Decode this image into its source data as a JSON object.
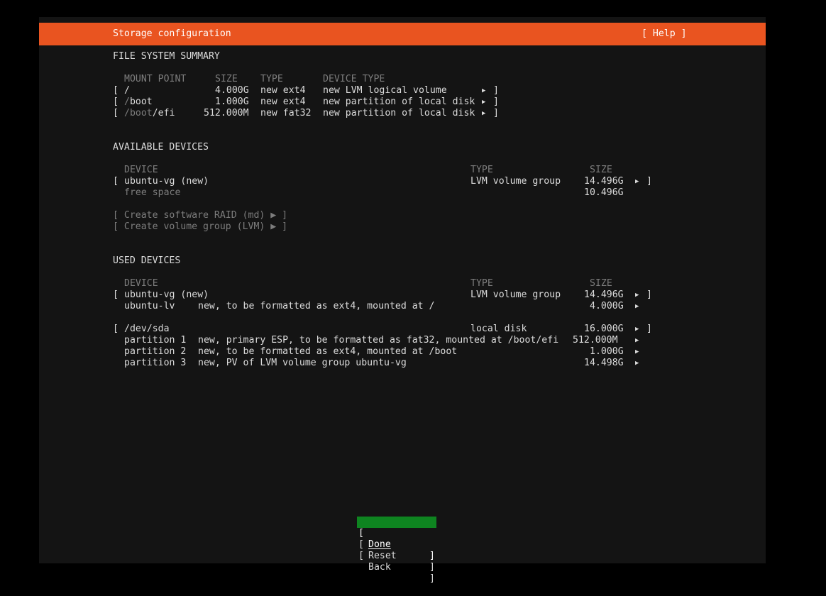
{
  "header": {
    "title": "Storage configuration",
    "help": "[ Help ]"
  },
  "fs_summary": {
    "heading": "FILE SYSTEM SUMMARY",
    "columns": {
      "mount": "MOUNT POINT",
      "size": "SIZE",
      "type": "TYPE",
      "device_type": "DEVICE TYPE"
    },
    "rows": [
      {
        "mount_dim": "",
        "mount": "/",
        "size": "4.000G",
        "type": "new ext4",
        "device_type": "new LVM logical volume"
      },
      {
        "mount_dim": "/",
        "mount": "boot",
        "size": "1.000G",
        "type": "new ext4",
        "device_type": "new partition of local disk"
      },
      {
        "mount_dim": "/boot",
        "mount": "/efi",
        "size": "512.000M",
        "type": "new fat32",
        "device_type": "new partition of local disk"
      }
    ]
  },
  "available": {
    "heading": "AVAILABLE DEVICES",
    "columns": {
      "device": "DEVICE",
      "type": "TYPE",
      "size": "SIZE"
    },
    "vg": {
      "name": "ubuntu-vg (new)",
      "type": "LVM volume group",
      "size": "14.496G"
    },
    "free": {
      "label": "free space",
      "size": "10.496G"
    },
    "actions": [
      "[ Create software RAID (md) ▶ ]",
      "[ Create volume group (LVM) ▶ ]"
    ]
  },
  "used": {
    "heading": "USED DEVICES",
    "columns": {
      "device": "DEVICE",
      "type": "TYPE",
      "size": "SIZE"
    },
    "vg": {
      "name": "ubuntu-vg (new)",
      "type": "LVM volume group",
      "size": "14.496G"
    },
    "lv": {
      "name": "ubuntu-lv",
      "desc": "new, to be formatted as ext4, mounted at /",
      "size": "4.000G"
    },
    "disk": {
      "name": "/dev/sda",
      "type": "local disk",
      "size": "16.000G"
    },
    "partitions": [
      {
        "name": "partition 1",
        "desc": "new, primary ESP, to be formatted as fat32, mounted at /boot/efi",
        "size": "512.000M"
      },
      {
        "name": "partition 2",
        "desc": "new, to be formatted as ext4, mounted at /boot",
        "size": "1.000G"
      },
      {
        "name": "partition 3",
        "desc": "new, PV of LVM volume group ubuntu-vg",
        "size": "14.498G"
      }
    ]
  },
  "buttons": {
    "done": "Done",
    "reset": "Reset",
    "back": "Back"
  },
  "glyphs": {
    "arrow": "▶",
    "open": "[",
    "close": "]"
  }
}
